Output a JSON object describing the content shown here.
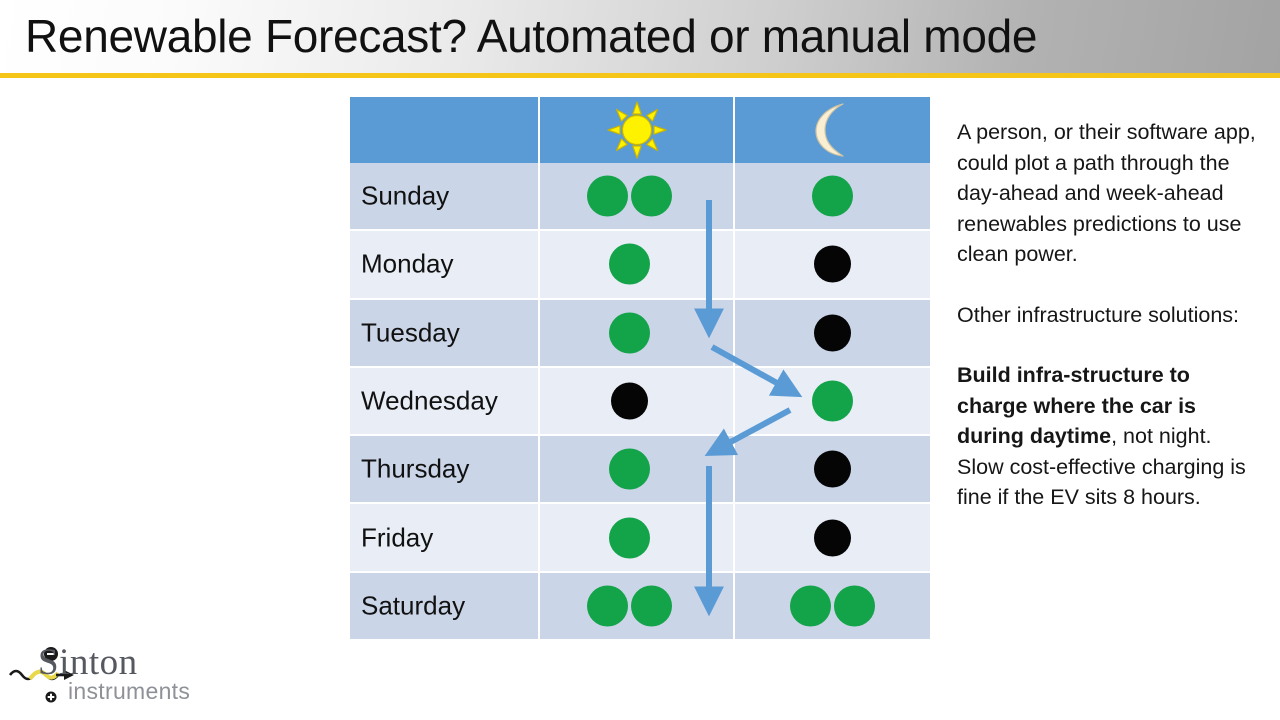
{
  "slide": {
    "title": "Renewable Forecast?  Automated or manual mode",
    "accent_color": "#F5C518",
    "header_color": "#5B9BD5",
    "row_color_odd": "#CBD5E8",
    "row_color_even": "#E8EDF6",
    "green_color": "#13A349",
    "black_color": "#050505",
    "arrow_color": "#5B9BD5"
  },
  "table": {
    "columns": [
      {
        "label": "",
        "icon": "none"
      },
      {
        "label": "",
        "icon": "sun-icon"
      },
      {
        "label": "",
        "icon": "moon-icon"
      }
    ],
    "rows": [
      {
        "day": "Sunday",
        "day_dots": [
          "green",
          "green"
        ],
        "night_dots": [
          "green"
        ]
      },
      {
        "day": "Monday",
        "day_dots": [
          "green"
        ],
        "night_dots": [
          "black"
        ]
      },
      {
        "day": "Tuesday",
        "day_dots": [
          "green"
        ],
        "night_dots": [
          "black"
        ]
      },
      {
        "day": "Wednesday",
        "day_dots": [
          "black"
        ],
        "night_dots": [
          "green"
        ]
      },
      {
        "day": "Thursday",
        "day_dots": [
          "green"
        ],
        "night_dots": [
          "black"
        ]
      },
      {
        "day": "Friday",
        "day_dots": [
          "green"
        ],
        "night_dots": [
          "black"
        ]
      },
      {
        "day": "Saturday",
        "day_dots": [
          "green",
          "green"
        ],
        "night_dots": [
          "green",
          "green"
        ]
      }
    ]
  },
  "side_panel": {
    "paragraph_1": "A person, or their software app, could plot a path through the day-ahead and week-ahead renewables predictions to use clean power.",
    "paragraph_2": "Other infrastructure solutions:",
    "paragraph_3_bold": "Build infra-structure to charge where the car is during daytime",
    "paragraph_3_rest": ", not night. Slow cost-effective charging is fine if the EV sits 8 hours."
  },
  "logo": {
    "word": "Sinton",
    "subtitle": "instruments",
    "charge_minus": "−",
    "charge_plus": "+"
  }
}
